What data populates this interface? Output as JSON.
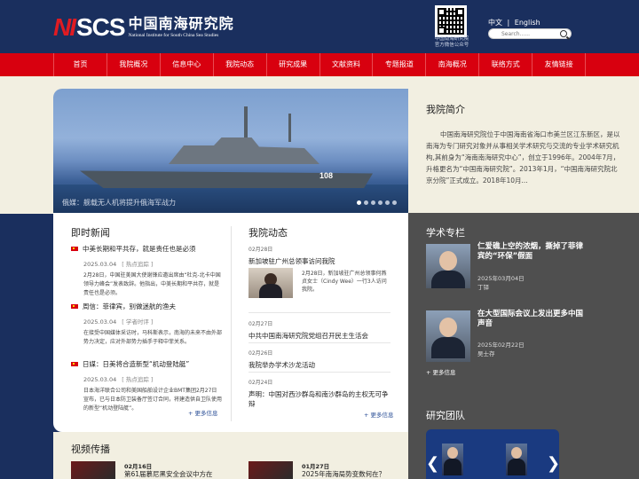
{
  "header": {
    "logo_mark": "NI",
    "logo_scs": "SCS",
    "logo_cn": "中国南海研究院",
    "logo_en": "National Institute for South China Sea Studies",
    "qr_caption_1": "中国南海研究院",
    "qr_caption_2": "官方微信公众号",
    "lang_cn": "中文",
    "lang_sep": "|",
    "lang_en": "English",
    "search_placeholder": "Search......"
  },
  "nav": [
    "首页",
    "我院概况",
    "信息中心",
    "我院动态",
    "研究成果",
    "文献资料",
    "专题报道",
    "南海概况",
    "联络方式",
    "友情链接"
  ],
  "hero": {
    "hull_number": "108",
    "caption": "俄媒：舰载无人机将提升俄海军战力",
    "slide_count": 6,
    "active_slide": 0
  },
  "intro": {
    "title": "我院简介",
    "text": "中国南海研究院位于中国海南省海口市美兰区江东新区，是以南海为专门研究对象并从事相关学术研究与交流的专业学术研究机构,其前身为“海南南海研究中心”，创立于1996年。2004年7月，升格更名为“中国南海研究院”。2013年1月，“中国南海研究院北京分院”正式成立。2018年10月..."
  },
  "news": {
    "title": "即时新闻",
    "more": "+ 更多信息",
    "items": [
      {
        "title": "中美长期和平共存，就是责任也是必须",
        "date": "2025.03.04",
        "tag": "[ 热点追踪 ]",
        "desc": "2月28日，中国驻美国大使谢锋应邀出席由“杜克-北卡中国领导力峰会”发表致辞。他指出，中美长期和平共存，就是责任也是必须。"
      },
      {
        "title": "周信：菲律宾，别做迷航的渔夫",
        "date": "2025.03.04",
        "tag": "[ 学者时评 ]",
        "desc": "在接受中国媒体采访时，马科斯表示，南海的未来不由外部势力决定，应对外部势力插手于释中菲关系。"
      },
      {
        "title": "日媒：日美将合造新型“机动登陆艇”",
        "date": "2025.03.04",
        "tag": "[ 热点追踪 ]",
        "desc": "日本海洋联合公司和美国船舶设计企业BMT集团2月27日宣布，已与日本防卫装备厅签订合同，将建造供自卫队使用的新型“机动登陆艇”。"
      }
    ]
  },
  "activities": {
    "title": "我院动态",
    "more": "+ 更多信息",
    "items": [
      {
        "date": "02月28日",
        "title": "新加坡驻广州总领事访问我院",
        "snippet": "2月28日，新加坡驻广州总领事何燕贞女士（Cindy Wee）一行3人访问我院。"
      },
      {
        "date": "02月27日",
        "title": "中共中国南海研究院党组召开民主生活会"
      },
      {
        "date": "02月26日",
        "title": "我院举办学术沙龙活动"
      },
      {
        "date": "02月24日",
        "title": "声明：中国对西沙群岛和南沙群岛的主权无可争辩"
      }
    ]
  },
  "scholars": {
    "title": "学术专栏",
    "more": "+ 更多信息",
    "items": [
      {
        "title": "仁爱礁上空的浓烟，撕掉了菲律宾的“环保”假面",
        "date": "2025年03月04日",
        "name": "丁铎"
      },
      {
        "title": "在大型国际会议上发出更多中国声音",
        "date": "2025年02月22日",
        "name": "吴士存"
      }
    ]
  },
  "team": {
    "title": "研究团队",
    "prev": "❮",
    "next": "❯"
  },
  "video": {
    "title": "视频传播",
    "items": [
      {
        "date": "02月16日",
        "text": "第61届慕尼黑安全会议中方在"
      },
      {
        "date": "01月27日",
        "text": "2025年南海局势变数何在？"
      }
    ]
  },
  "colors": {
    "header_bg": "#1a2f5e",
    "nav_bg": "#d8000f",
    "accent_red": "#e01b22",
    "cream": "#f2efe1",
    "grey": "#4f4f4f"
  }
}
